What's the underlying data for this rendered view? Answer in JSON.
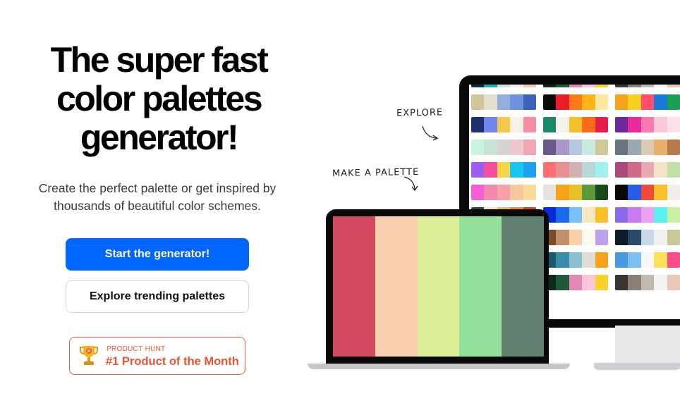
{
  "hero": {
    "headline_lines": [
      "The super fast",
      "color palettes",
      "generator!"
    ],
    "subtitle_lines": [
      "Create the perfect palette or get inspired by",
      "thousands of beautiful color schemes."
    ],
    "primary_button": "Start the generator!",
    "secondary_button": "Explore trending palettes"
  },
  "badge": {
    "small_label": "PRODUCT HUNT",
    "title": "#1 Product of the Month",
    "icon": "trophy-icon",
    "color": "#e85535"
  },
  "annotations": {
    "explore": "EXPLORE",
    "make_palette": "MAKE A PALETTE"
  },
  "colors": {
    "primary": "#0066ff",
    "badge": "#e85535"
  },
  "laptop_palette": [
    "#d14a60",
    "#f7cfae",
    "#dcef96",
    "#93e09a",
    "#628070"
  ],
  "monitor_palettes": [
    [
      [
        "#0d2b3e",
        "#17b0b0",
        "#cde5dd",
        "#f8edec",
        "#f2ceaa"
      ],
      [
        "#d2c49a",
        "#e4e0d0",
        "#94aee0",
        "#6e92e0",
        "#3a62b8"
      ],
      [
        "#1e2f6e",
        "#6f86f0",
        "#f5c74a",
        "#f9f1e8",
        "#f48fa4"
      ],
      [
        "#c6f4df",
        "#c8e3d6",
        "#d8d3d3",
        "#f0c6cd",
        "#f0a6b4"
      ],
      [
        "#9a5ef0",
        "#f24fa0",
        "#f6d548",
        "#19c6ee",
        "#1ea0f0"
      ],
      [
        "#f55fd6",
        "#f58ab0",
        "#f8a0a8",
        "#f7c89c",
        "#fadc98"
      ],
      [
        "#2e4a3c",
        "#f0e6c8",
        "#e8bd58",
        "#e88a3a",
        "#d04a2a"
      ],
      [
        "#3a2d6a",
        "#6c4fb0",
        "#9a7ad8",
        "#c8b0ee",
        "#ebe2fa"
      ],
      [
        "#0e3b5e",
        "#1a6a8e",
        "#2a9ac0",
        "#7ad0e8",
        "#d8f2fa"
      ],
      [
        "#5a2a1e",
        "#9a4a2a",
        "#d88a4a",
        "#f2c88a",
        "#faead0"
      ]
    ],
    [
      [
        "#0d2a1e",
        "#1e5a3a",
        "#e387b5",
        "#f7c6da",
        "#f9d32a"
      ],
      [
        "#0a0a0a",
        "#e81e2a",
        "#ff7a1a",
        "#ffb31a",
        "#fde8a0"
      ],
      [
        "#1a8a6a",
        "#f7f2e8",
        "#f5c12a",
        "#ff6a1a",
        "#e81e4a"
      ],
      [
        "#6a5a8a",
        "#a898c8",
        "#b8c8e0",
        "#c8e8e0",
        "#d0c898"
      ],
      [
        "#f87070",
        "#e89090",
        "#d0b0b0",
        "#b8d8d8",
        "#a0f0f0"
      ],
      [
        "#e8e2de",
        "#f5a31a",
        "#e8c02a",
        "#5a9a3a",
        "#1a4a1a"
      ],
      [
        "#0a2ad8",
        "#1a6af0",
        "#7ac0f8",
        "#f8e8c0",
        "#fac02a"
      ],
      [
        "#7a4a2a",
        "#c0906a",
        "#f8d0a8",
        "#fafaf0",
        "#c0a0e8"
      ],
      [
        "#1a5a6a",
        "#3a8aaa",
        "#8ac0d0",
        "#e0ddd5",
        "#f7a31a"
      ],
      [
        "#0d2a1e",
        "#1e5a3a",
        "#e387b5",
        "#f7c6da",
        "#f9d32a"
      ]
    ],
    [
      [
        "#3a3430",
        "#8a8078",
        "#c0bab3",
        "#f4f2f0",
        "#e8c9b8"
      ],
      [
        "#f5a31a",
        "#f8d020",
        "#ff4d6a",
        "#1a7ad8",
        "#1aa050"
      ],
      [
        "#6a2a9a",
        "#e82a9a",
        "#f87ab0",
        "#fbc8d8",
        "#fbe0ea"
      ],
      [
        "#6a747a",
        "#9aa8b0",
        "#d8ccb4",
        "#e8b06a",
        "#b87a4a"
      ],
      [
        "#a84a7a",
        "#d06a8a",
        "#e8a8b0",
        "#f2e2c8",
        "#c0e0a8"
      ],
      [
        "#0a0a0a",
        "#2a5ae8",
        "#f04a3a",
        "#fac02a",
        "#f2eee8"
      ],
      [
        "#8a6ae8",
        "#c87af0",
        "#f0a0f0",
        "#5af0f0",
        "#c8f0a0"
      ],
      [
        "#0d1a2a",
        "#2a4a6a",
        "#c8d8e8",
        "#f0f0f0",
        "#c8c898"
      ],
      [
        "#4a9ae0",
        "#7ac0f0",
        "#f8f8f8",
        "#ffe05a",
        "#ff4d8a"
      ],
      [
        "#3a3430",
        "#8a8078",
        "#c0bab3",
        "#f4f2f0",
        "#e8c9b8"
      ]
    ]
  ]
}
